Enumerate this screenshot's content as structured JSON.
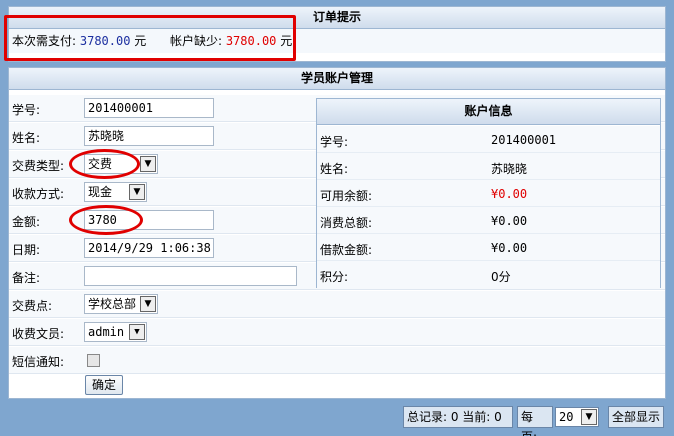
{
  "order": {
    "title": "订单提示",
    "pay_label": "本次需支付:",
    "pay_amount": "3780.00",
    "pay_unit": "元",
    "short_label": "帐户缺少:",
    "short_amount": "3780.00",
    "short_unit": "元"
  },
  "panel_title": "学员账户管理",
  "form": {
    "student_no_label": "学号:",
    "student_no": "201400001",
    "name_label": "姓名:",
    "name": "苏晓晓",
    "fee_type_label": "交费类型:",
    "fee_type": "交费",
    "pay_method_label": "收款方式:",
    "pay_method": "现金",
    "amount_label": "金额:",
    "amount": "3780",
    "date_label": "日期:",
    "date": "2014/9/29 1:06:38",
    "remark_label": "备注:",
    "remark": "",
    "pay_point_label": "交费点:",
    "pay_point": "学校总部",
    "clerk_label": "收费文员:",
    "clerk": "admin",
    "sms_label": "短信通知:",
    "submit": "确定"
  },
  "account_info": {
    "title": "账户信息",
    "rows": [
      {
        "label": "学号:",
        "value": "201400001"
      },
      {
        "label": "姓名:",
        "value": "苏晓晓"
      },
      {
        "label": "可用余额:",
        "value": "¥0.00"
      },
      {
        "label": "消费总额:",
        "value": "¥0.00"
      },
      {
        "label": "借款金额:",
        "value": "¥0.00"
      },
      {
        "label": "积分:",
        "value": "0分"
      }
    ]
  },
  "pager": {
    "total": "总记录: 0 当前: 0",
    "per_page_label": "每页:",
    "per_page": "20",
    "show_all": "全部显示"
  },
  "colors": {
    "highlight": "#e00000",
    "amount_blue": "#1c2fa0"
  }
}
